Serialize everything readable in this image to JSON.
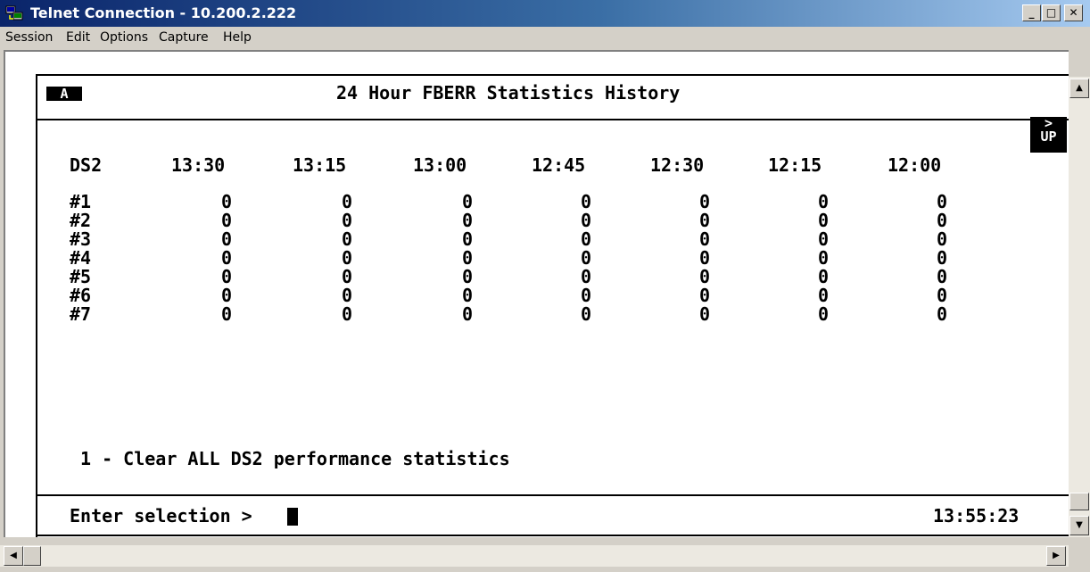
{
  "window": {
    "title": "Telnet Connection - 10.200.2.222",
    "minimize_glyph": "_",
    "maximize_glyph": "□",
    "close_glyph": "✕",
    "icon": "telnet-app-icon"
  },
  "menu": {
    "items": [
      "Session",
      "Edit",
      "Options",
      "Capture",
      "Help"
    ]
  },
  "terminal": {
    "screen_id": "A",
    "title": "24 Hour FBERR Statistics History",
    "up_arrow": ">",
    "up_label": "UP",
    "row_header": "DS2",
    "columns": [
      "13:30",
      "13:15",
      "13:00",
      "12:45",
      "12:30",
      "12:15",
      "12:00"
    ],
    "rows": [
      {
        "label": "#1",
        "values": [
          "0",
          "0",
          "0",
          "0",
          "0",
          "0",
          "0"
        ]
      },
      {
        "label": "#2",
        "values": [
          "0",
          "0",
          "0",
          "0",
          "0",
          "0",
          "0"
        ]
      },
      {
        "label": "#3",
        "values": [
          "0",
          "0",
          "0",
          "0",
          "0",
          "0",
          "0"
        ]
      },
      {
        "label": "#4",
        "values": [
          "0",
          "0",
          "0",
          "0",
          "0",
          "0",
          "0"
        ]
      },
      {
        "label": "#5",
        "values": [
          "0",
          "0",
          "0",
          "0",
          "0",
          "0",
          "0"
        ]
      },
      {
        "label": "#6",
        "values": [
          "0",
          "0",
          "0",
          "0",
          "0",
          "0",
          "0"
        ]
      },
      {
        "label": "#7",
        "values": [
          "0",
          "0",
          "0",
          "0",
          "0",
          "0",
          "0"
        ]
      }
    ],
    "option": "1 - Clear ALL DS2 performance statistics",
    "prompt": "Enter selection >",
    "clock": "13:55:23"
  },
  "scrollbars": {
    "up_arrow": "▲",
    "down_arrow": "▼",
    "left_arrow": "◀",
    "right_arrow": "▶"
  }
}
